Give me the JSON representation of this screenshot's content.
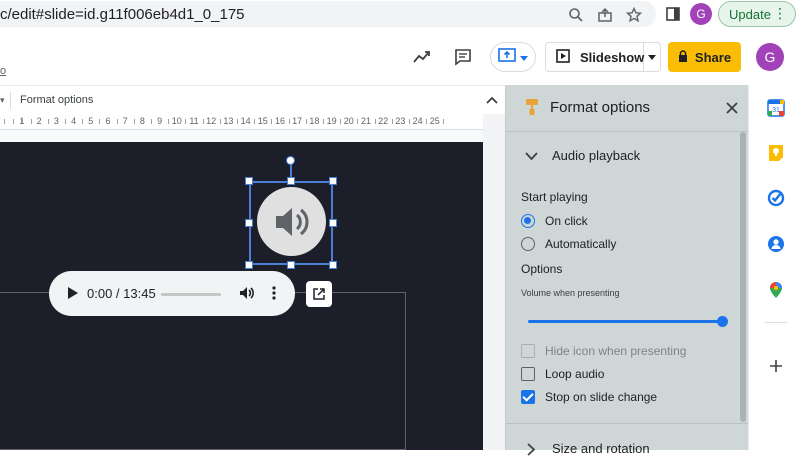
{
  "browser": {
    "url": "c/edit#slide=id.g11f006eb4d1_0_175",
    "avatar_letter": "G",
    "update_label": "Update",
    "icons": [
      "zoom-icon",
      "share-page-icon",
      "bookmark-star-icon",
      "side-panel-icon",
      "more-vert-icon"
    ]
  },
  "header": {
    "menu_stub": "o",
    "slideshow_label": "Slideshow",
    "share_label": "Share",
    "avatar_letter": "G",
    "share_color": "#fbbc04"
  },
  "toolbar": {
    "format_options_label": "Format options"
  },
  "ruler": {
    "numbers": [
      "1",
      "2",
      "3",
      "4",
      "5",
      "6",
      "7",
      "8",
      "9",
      "10",
      "11",
      "12",
      "13",
      "14",
      "15",
      "16",
      "17",
      "18",
      "19",
      "20",
      "21",
      "22",
      "23",
      "24",
      "25"
    ]
  },
  "player": {
    "time": "0:00 / 13:45"
  },
  "panel": {
    "title": "Format options",
    "section_audio": "Audio playback",
    "start_playing": "Start playing",
    "on_click": "On click",
    "automatically": "Automatically",
    "options": "Options",
    "volume_label": "Volume when presenting",
    "volume_level": 1.0,
    "hide_icon": "Hide icon when presenting",
    "loop_audio": "Loop audio",
    "stop_on_change": "Stop on slide change",
    "section_size": "Size and rotation",
    "selected_start": "On click",
    "checks": {
      "hide_icon": false,
      "loop_audio": false,
      "stop_on_change": true
    }
  },
  "colors": {
    "accent": "#1a73e8",
    "selection": "#4a7fd4",
    "panel_bg": "#ced7d6",
    "slide_bg": "#1c1f2a",
    "avatar": "#a142b8"
  }
}
